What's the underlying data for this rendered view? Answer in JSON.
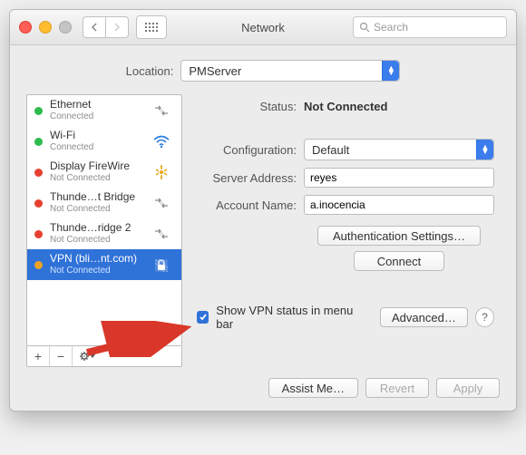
{
  "window": {
    "title": "Network",
    "search_placeholder": "Search"
  },
  "location": {
    "label": "Location:",
    "value": "PMServer"
  },
  "services": [
    {
      "name": "Ethernet",
      "sub": "Connected",
      "status": "green",
      "icon": "arrows"
    },
    {
      "name": "Wi-Fi",
      "sub": "Connected",
      "status": "green",
      "icon": "wifi"
    },
    {
      "name": "Display FireWire",
      "sub": "Not Connected",
      "status": "red",
      "icon": "firewire"
    },
    {
      "name": "Thunde…t Bridge",
      "sub": "Not Connected",
      "status": "red",
      "icon": "arrows"
    },
    {
      "name": "Thunde…ridge 2",
      "sub": "Not Connected",
      "status": "red",
      "icon": "arrows"
    },
    {
      "name": "VPN (bli…nt.com)",
      "sub": "Not Connected",
      "status": "orange",
      "icon": "lock"
    }
  ],
  "selected_index": 5,
  "detail": {
    "status_label": "Status:",
    "status_value": "Not Connected",
    "config_label": "Configuration:",
    "config_value": "Default",
    "server_label": "Server Address:",
    "server_value": "reyes",
    "account_label": "Account Name:",
    "account_value": "a.inocencia",
    "auth_btn": "Authentication Settings…",
    "connect_btn": "Connect",
    "show_status_label": "Show VPN status in menu bar",
    "show_status_checked": true,
    "advanced_btn": "Advanced…"
  },
  "footer": {
    "assist": "Assist Me…",
    "revert": "Revert",
    "apply": "Apply"
  },
  "list_btns": {
    "add": "+",
    "remove": "−",
    "cog": "⚙︎▾"
  }
}
